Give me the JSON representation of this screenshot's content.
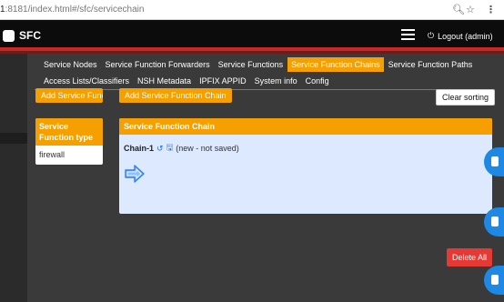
{
  "browser": {
    "url_prefix": "1",
    "url_rest": ":8181/index.html#/sfc/servicechain",
    "search_icon": "magnifier-icon",
    "star_icon": "star-icon",
    "menu_icon": "kebab-icon"
  },
  "header": {
    "brand": "SFC",
    "logout_label": "Logout (admin)",
    "colors": {
      "bar": "#0c0c0c",
      "stripe": "#c62828",
      "accent": "#f5a000"
    }
  },
  "nav": {
    "row1": [
      "Service Nodes",
      "Service Function Forwarders",
      "Service Functions",
      "Service Function Chains",
      "Service Function Paths"
    ],
    "row2": [
      "Access Lists/Classifiers",
      "NSH Metadata",
      "IPFIX APPID",
      "System info",
      "Config"
    ],
    "active": "Service Function Chains"
  },
  "buttons": {
    "add_sf": "Add Service Function",
    "add_sfc": "Add Service Function Chain",
    "clear_sorting": "Clear sorting",
    "delete_all": "Delete All"
  },
  "sf_type_card": {
    "title": "Service Function type",
    "items": [
      "firewall"
    ]
  },
  "chain_panel": {
    "title": "Service Function Chain",
    "chain_name": "Chain-1",
    "status": "(new - not saved)"
  }
}
